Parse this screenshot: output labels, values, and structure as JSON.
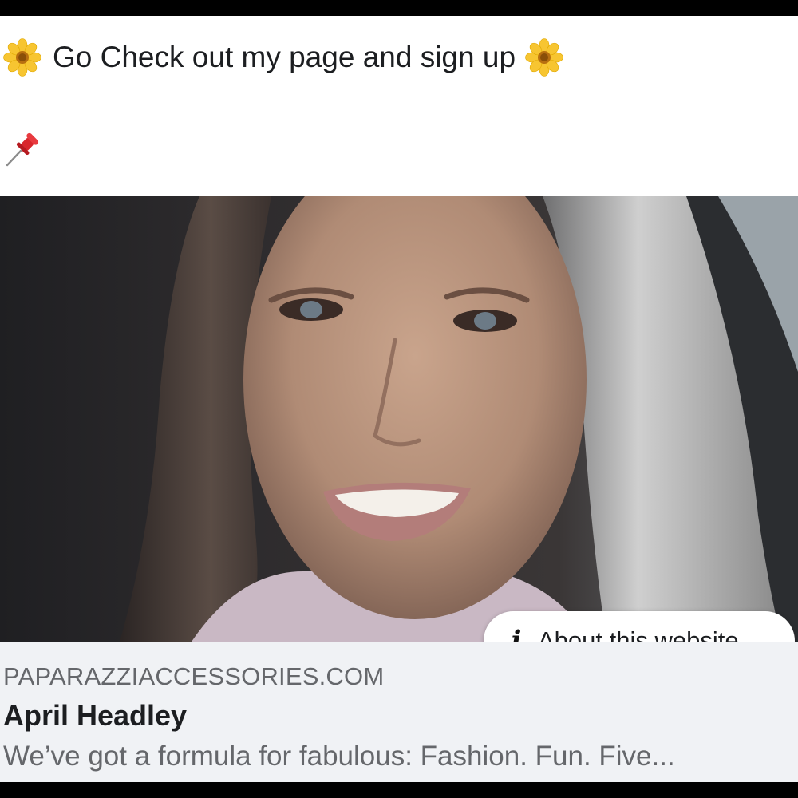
{
  "post": {
    "caption": {
      "leading_icon": "sunflower-emoji-icon",
      "text": "Go Check out my page and sign up",
      "trailing_icon": "sunflower-emoji-icon",
      "second_line_icon": "pushpin-emoji-icon"
    },
    "link_preview": {
      "image_subject": "selfie-photo",
      "about_button": {
        "icon": "info-icon",
        "icon_glyph": "i",
        "label": "About this website"
      },
      "domain": "PAPARAZZIACCESSORIES.COM",
      "title": "April Headley",
      "description": "We’ve got a formula for fabulous: Fashion. Fun. Five..."
    }
  },
  "colors": {
    "text_primary": "#1c1e21",
    "text_secondary": "#65676b",
    "meta_background": "#f0f2f5",
    "flower_petal": "#f7c531",
    "pin_red": "#d8262c"
  }
}
